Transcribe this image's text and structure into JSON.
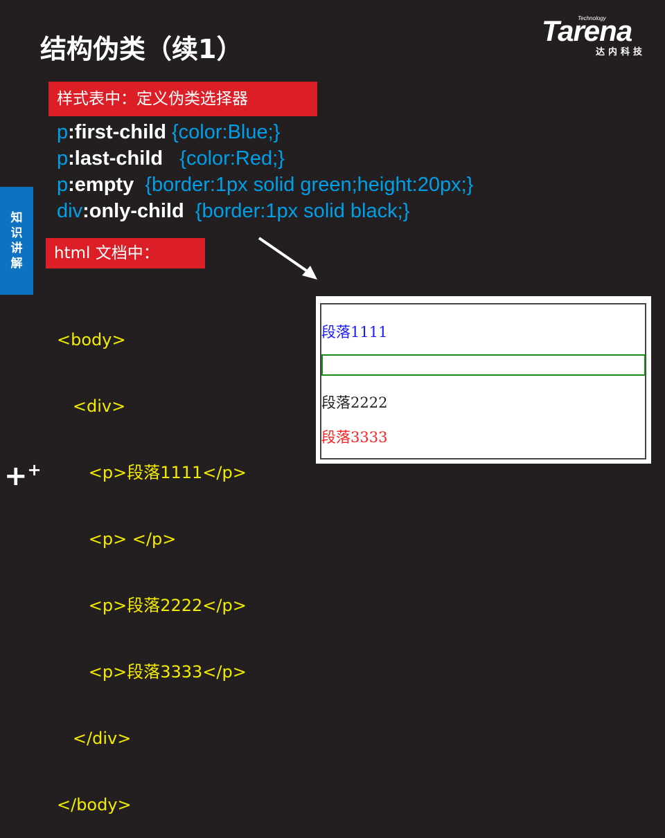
{
  "title": "结构伪类（续1）",
  "logo": {
    "brand": "Tarena",
    "tag": "Technology",
    "cn": "达内科技"
  },
  "sidebar_label": [
    "知",
    "识",
    "讲",
    "解"
  ],
  "stylesheet_heading": "样式表中：定义伪类选择器",
  "css_rules": [
    {
      "element": "p",
      "pseudo": ":first-child",
      "decl": " {color:Blue;}"
    },
    {
      "element": "p",
      "pseudo": ":last-child",
      "decl": "   {color:Red;}"
    },
    {
      "element": "p",
      "pseudo": ":empty",
      "decl": "  {border:1px solid green;height:20px;}"
    },
    {
      "element": "div",
      "pseudo": ":only-child",
      "decl": "  {border:1px solid black;}"
    }
  ],
  "html_heading": "html 文档中：",
  "html_lines": [
    "<body>",
    "   <div>",
    "      <p>段落1111</p>",
    "      <p> </p>",
    "      <p>段落2222</p>",
    "      <p>段落3333</p>",
    "   </div>",
    "</body>"
  ],
  "demo": {
    "p1": "段落1111",
    "p3": "段落2222",
    "p4": "段落3333",
    "colors": {
      "p1": "#1a1aff",
      "p3": "#222222",
      "p4": "#ff2020",
      "border": "#1a8a1a"
    }
  },
  "colors": {
    "bg": "#231f20",
    "red": "#dc1f26",
    "cyan": "#00a0e9",
    "yellow": "#f2ec00",
    "blue": "#0e72c3"
  }
}
